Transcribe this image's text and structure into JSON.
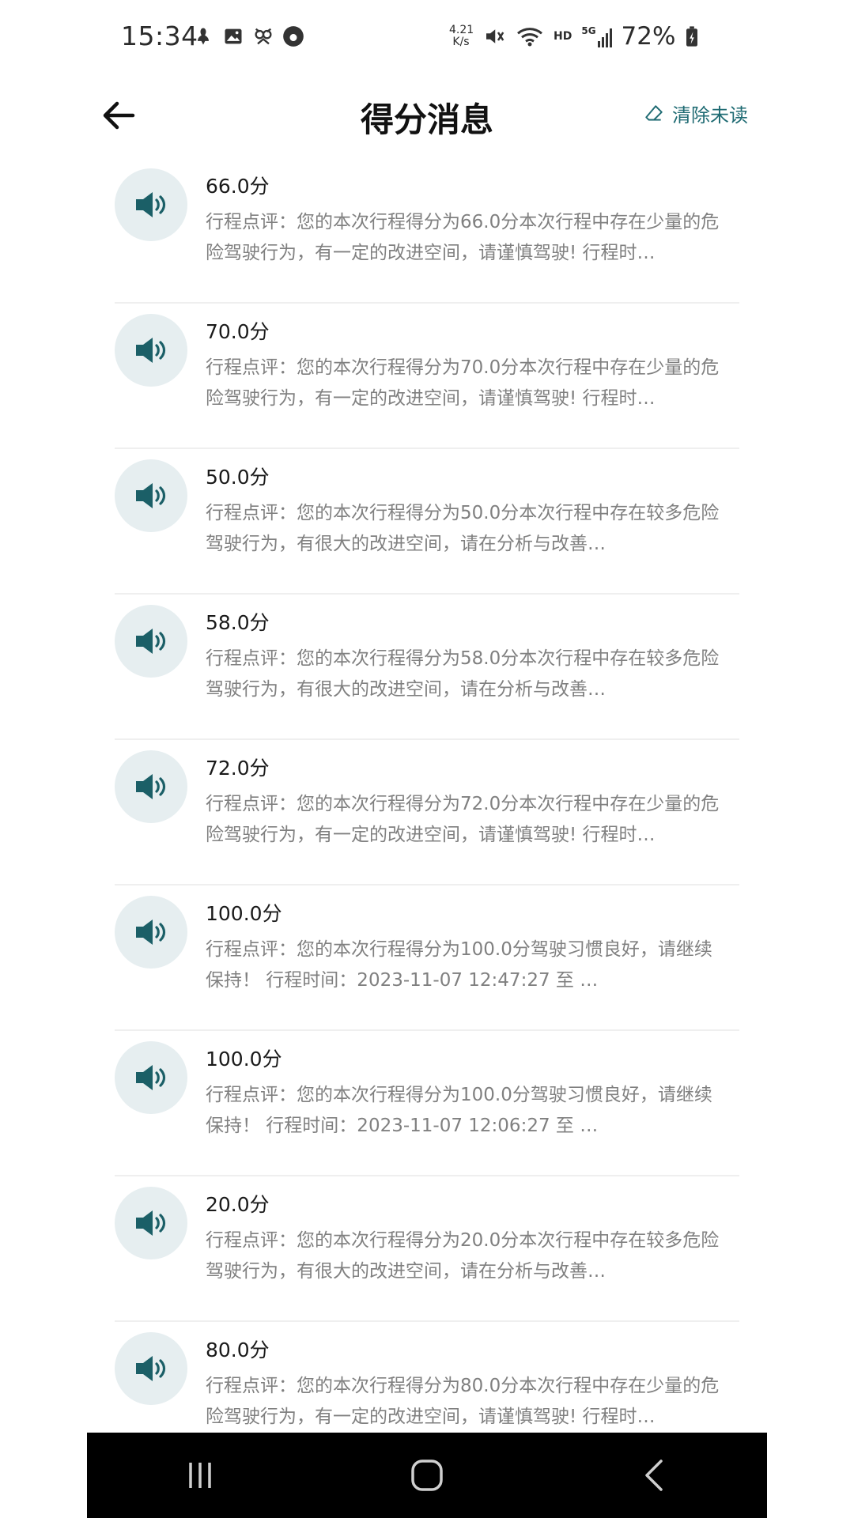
{
  "status_bar": {
    "time": "15:34",
    "net_speed_value": "4.21",
    "net_speed_unit": "K/s",
    "hd_label": "HD",
    "signal_label": "5G",
    "battery_percent": "72%"
  },
  "header": {
    "title": "得分消息",
    "clear_unread_label": "清除未读"
  },
  "colors": {
    "accent": "#1f6b73",
    "icon_bg": "#e6eef0",
    "body_text": "#808080"
  },
  "messages": [
    {
      "score": "66.0分",
      "body": "行程点评：您的本次行程得分为66.0分本次行程中存在少量的危险驾驶行为，有一定的改进空间，请谨慎驾驶! 行程时…"
    },
    {
      "score": "70.0分",
      "body": "行程点评：您的本次行程得分为70.0分本次行程中存在少量的危险驾驶行为，有一定的改进空间，请谨慎驾驶! 行程时…"
    },
    {
      "score": "50.0分",
      "body": "行程点评：您的本次行程得分为50.0分本次行程中存在较多危险驾驶行为，有很大的改进空间，请在分析与改善…"
    },
    {
      "score": "58.0分",
      "body": "行程点评：您的本次行程得分为58.0分本次行程中存在较多危险驾驶行为，有很大的改进空间，请在分析与改善…"
    },
    {
      "score": "72.0分",
      "body": "行程点评：您的本次行程得分为72.0分本次行程中存在少量的危险驾驶行为，有一定的改进空间，请谨慎驾驶! 行程时…"
    },
    {
      "score": "100.0分",
      "body": "行程点评：您的本次行程得分为100.0分驾驶习惯良好，请继续保持！ 行程时间：2023-11-07 12:47:27 至 …"
    },
    {
      "score": "100.0分",
      "body": "行程点评：您的本次行程得分为100.0分驾驶习惯良好，请继续保持！ 行程时间：2023-11-07 12:06:27 至 …"
    },
    {
      "score": "20.0分",
      "body": "行程点评：您的本次行程得分为20.0分本次行程中存在较多危险驾驶行为，有很大的改进空间，请在分析与改善…"
    },
    {
      "score": "80.0分",
      "body": "行程点评：您的本次行程得分为80.0分本次行程中存在少量的危险驾驶行为，有一定的改进空间，请谨慎驾驶! 行程时…"
    }
  ],
  "nav": {
    "recents_icon": "recents-icon",
    "home_icon": "home-icon",
    "back_icon": "back-icon"
  }
}
